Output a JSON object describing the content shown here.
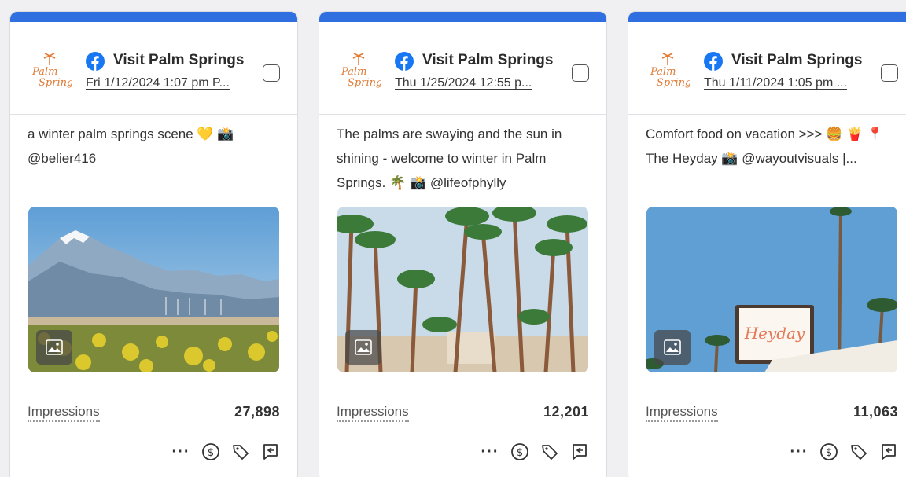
{
  "accent": "#2f6fe0",
  "cards": [
    {
      "brand": "Visit Palm Springs",
      "date": "Fri 1/12/2024 1:07 pm P...",
      "caption": "a winter palm springs scene 💛 📸 @belier416",
      "metric_label": "Impressions",
      "metric_value": "27,898",
      "photo": "mountains-desert-flowers"
    },
    {
      "brand": "Visit Palm Springs",
      "date": "Thu 1/25/2024 12:55 p...",
      "caption": "The palms are swaying and the sun in shining - welcome to winter in Palm Springs. 🌴 📸 @lifeofphylly",
      "metric_label": "Impressions",
      "metric_value": "12,201",
      "photo": "palm-trees"
    },
    {
      "brand": "Visit Palm Springs",
      "date": "Thu 1/11/2024 1:05 pm ...",
      "caption": "Comfort food on vacation >>> 🍔 🍟 📍 The Heyday 📸 @wayoutvisuals |...",
      "metric_label": "Impressions",
      "metric_value": "11,063",
      "photo": "heyday-sign",
      "sign_text": "Heyday"
    }
  ],
  "logo": {
    "line1": "Palm",
    "line2": "Springs",
    "color": "#e07a35"
  },
  "icons": [
    "facebook-icon",
    "more-icon",
    "dollar-icon",
    "tag-icon",
    "reply-icon",
    "image-icon"
  ]
}
